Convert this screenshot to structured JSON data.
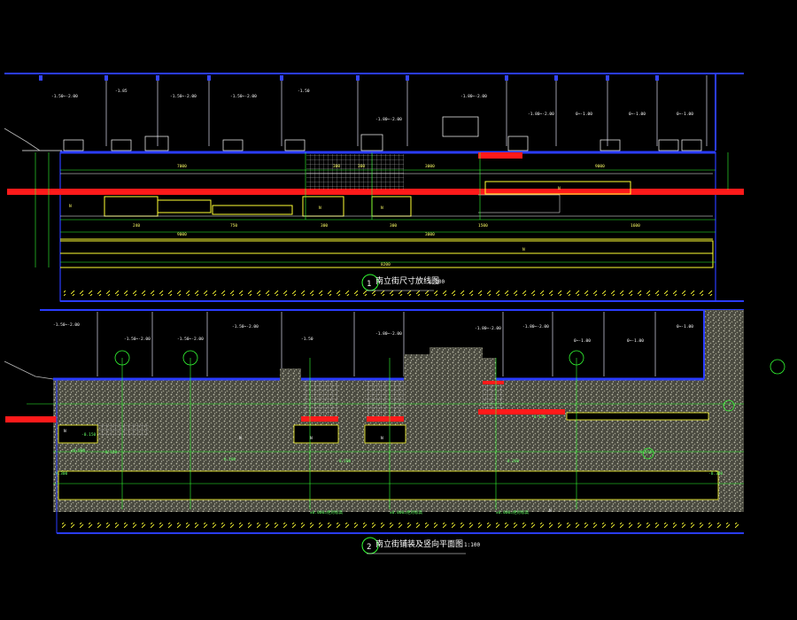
{
  "drawing": {
    "upper_plan": {
      "title": "南立街尺寸放线图",
      "scale": "1:100",
      "symbol": "1"
    },
    "lower_plan": {
      "title": "南立街铺装及竖向平面图",
      "scale": "1:100",
      "symbol": "2"
    },
    "colors": {
      "background": "#000000",
      "building_blue": "#2a3cff",
      "road_red": "#ff1a1a",
      "dimension_green": "#33ff33",
      "edge_yellow": "#ffff33",
      "wall_grey": "#9a9aa8",
      "paving_texture": "#8c8c7a"
    }
  }
}
